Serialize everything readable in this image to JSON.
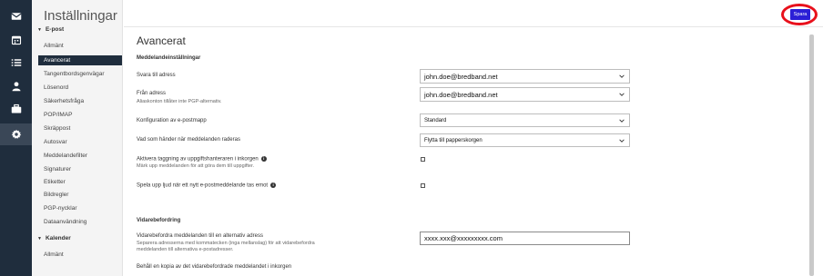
{
  "rail": {
    "items": [
      {
        "icon": "mail-icon"
      },
      {
        "icon": "calendar-icon"
      },
      {
        "icon": "list-icon"
      },
      {
        "icon": "contact-icon"
      },
      {
        "icon": "briefcase-icon"
      },
      {
        "icon": "gear-icon",
        "active": true
      }
    ]
  },
  "sidebar": {
    "title": "Inställningar",
    "email_section": "E-post",
    "items": [
      {
        "label": "Allmänt"
      },
      {
        "label": "Avancerat",
        "active": true
      },
      {
        "label": "Tangentbordsgenvägar"
      },
      {
        "label": "Lösenord"
      },
      {
        "label": "Säkerhetsfråga"
      },
      {
        "label": "POP/IMAP"
      },
      {
        "label": "Skräppost"
      },
      {
        "label": "Autosvar"
      },
      {
        "label": "Meddelandefilter"
      },
      {
        "label": "Signaturer"
      },
      {
        "label": "Etiketter"
      },
      {
        "label": "Bildregler"
      },
      {
        "label": "PGP-nycklar"
      },
      {
        "label": "Dataanvändning"
      }
    ],
    "calendar_section": "Kalender",
    "calendar_items": [
      {
        "label": "Allmänt"
      }
    ]
  },
  "toolbar": {
    "save_label": "Spara",
    "accent_color": "#2b1fd6",
    "highlight_color": "#e8101b"
  },
  "main": {
    "title": "Avancerat",
    "message_settings": {
      "heading": "Meddelandeinställningar",
      "reply_to": {
        "label": "Svara till adress",
        "value": "john.doe@bredband.net"
      },
      "from": {
        "label": "Från adress",
        "hint": "Aliaskonton tillåter inte PGP-alternativ.",
        "value": "john.doe@bredband.net"
      },
      "folder_config": {
        "label": "Konfiguration av e-postmapp",
        "value": "Standard"
      },
      "on_delete": {
        "label": "Vad som händer när meddelanden raderas",
        "value": "Flytta till papperskorgen"
      },
      "task_tagging": {
        "label": "Aktivera taggning av uppgiftshanteraren i inkorgen",
        "hint": "Märk upp meddelanden för att göra dem till uppgifter."
      },
      "play_sound": {
        "label": "Spela upp ljud när ett nytt e-postmeddelande tas emot"
      }
    },
    "forwarding": {
      "heading": "Vidarebefordring",
      "forward_to": {
        "label": "Vidarebefordra meddelanden till en alternativ adress",
        "hint_line1": "Separera adresserna med kommatecken (inga mellanslag) för att vidarebefordra",
        "hint_line2": "meddelanden till alternativa e-postadresser.",
        "value": "xxxx.xxx@xxxxxxxxx.com"
      },
      "keep_copy": {
        "label": "Behåll en kopia av det vidarebefordrade meddelandet i inkorgen"
      }
    }
  }
}
